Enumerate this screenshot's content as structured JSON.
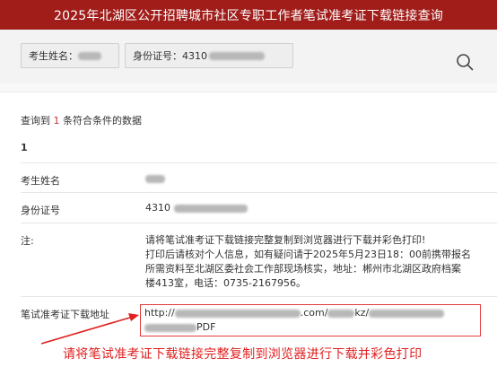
{
  "header": {
    "title": "2025年北湖区公开招聘城市社区专职工作者笔试准考证下载链接查询"
  },
  "search": {
    "name_label": "考生姓名：",
    "id_label": "身份证号：",
    "id_prefix": "4310"
  },
  "result": {
    "prefix": "查询到",
    "count": "1",
    "suffix": "条符合条件的数据",
    "index": "1"
  },
  "fields": {
    "name_label": "考生姓名",
    "id_label": "身份证号",
    "id_prefix": "4310",
    "note_label": "注:",
    "note_lines": [
      "请将笔试准考证下载链接完整复制到浏览器进行下载并彩色打印!",
      "打印后请核对个人信息，如有疑问请于2025年5月23日18：00前携带报名",
      "所需资料至北湖区委社会工作部现场核实，地址：郴州市北湖区政府档案",
      "楼413室，电话：0735-2167956。"
    ],
    "link_label": "笔试准考证下载地址",
    "link_start": "http://",
    "link_mid": ".com/",
    "link_kz": "kz/",
    "link_end": "PDF"
  },
  "annotation": {
    "text": "请将笔试准考证下载链接完整复制到浏览器进行下载并彩色打印"
  },
  "colors": {
    "title_bg": "#a01d1a",
    "accent_red": "#e02020"
  }
}
